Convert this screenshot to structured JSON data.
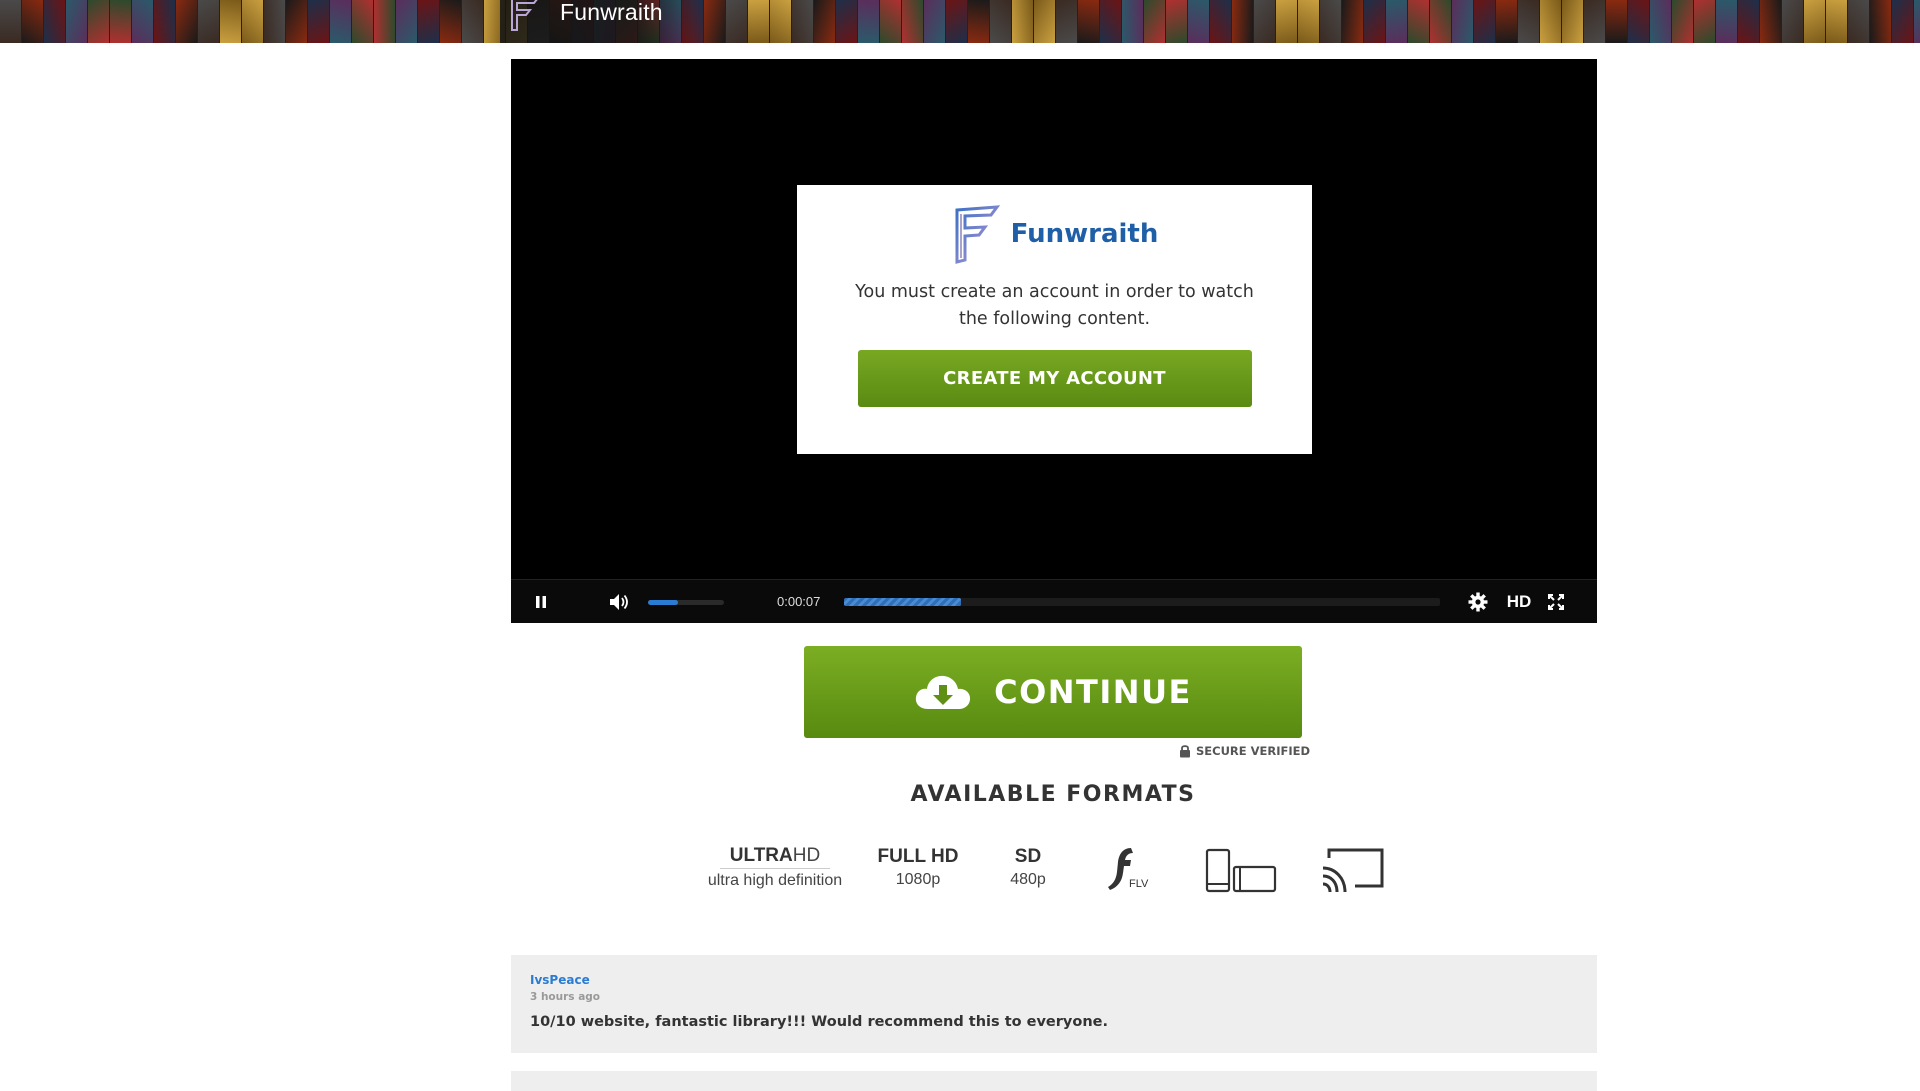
{
  "header": {
    "title": "Funwraith"
  },
  "player": {
    "modal": {
      "brand": "Funwraith",
      "message": "You must create an account in order to watch the following content.",
      "button_label": "CREATE MY ACCOUNT"
    },
    "controls": {
      "time": "0:00:07",
      "quality_label": "HD",
      "volume_fraction": 0.4,
      "progress_fraction": 0.197
    }
  },
  "cta": {
    "continue_label": "CONTINUE",
    "secure_label": "SECURE VERIFIED"
  },
  "formats": {
    "title": "AVAILABLE FORMATS",
    "uhd": {
      "main_bold": "ULTRA",
      "main_thin": "HD",
      "sub": "ultra high definition"
    },
    "fhd": {
      "main": "FULL HD",
      "sub": "1080p"
    },
    "sd": {
      "main": "SD",
      "sub": "480p"
    },
    "flv": {
      "label": "FLV"
    }
  },
  "comments": [
    {
      "user": "IvsPeace",
      "time": "3 hours ago",
      "text": "10/10 website, fantastic library!!! Would recommend this to everyone."
    }
  ],
  "colors": {
    "accent_green": "#6b9c1a",
    "brand_blue": "#1f5fa8",
    "link_blue": "#2a7cd3"
  }
}
